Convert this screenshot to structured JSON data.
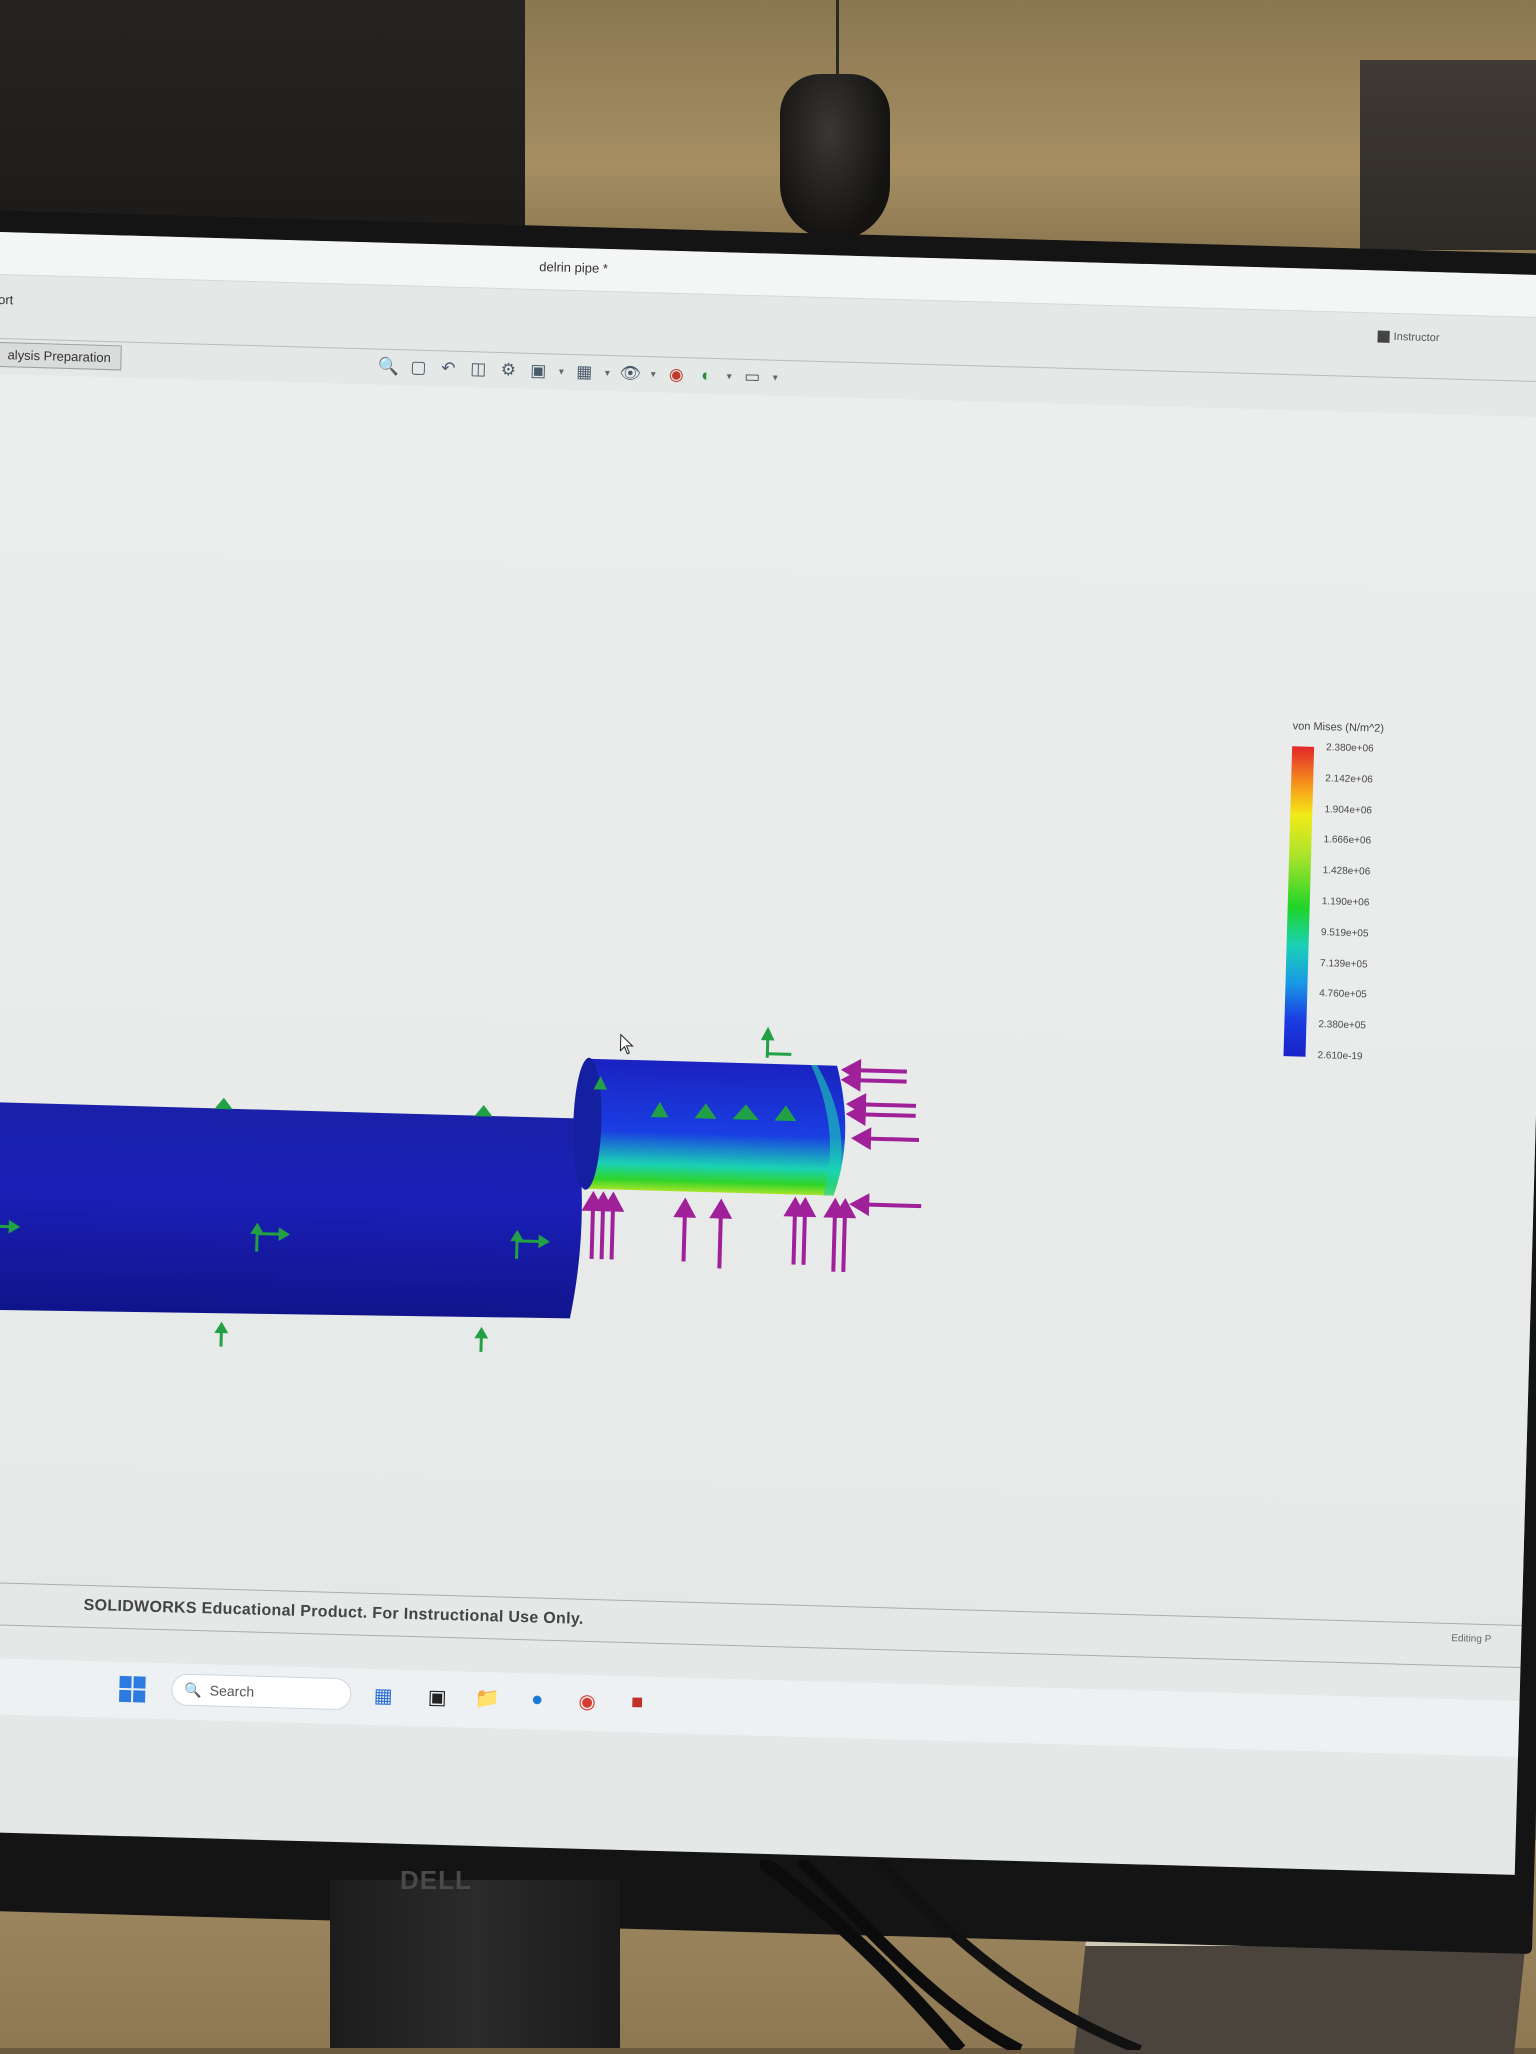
{
  "window": {
    "document_title": "delrin pipe *",
    "menu_fragment": "ort",
    "addin_label": "Instructor"
  },
  "command_tabs": {
    "active": "alysis Preparation"
  },
  "heads_up_toolbar": {
    "icons": [
      "zoom-to-fit-icon",
      "zoom-to-area-icon",
      "previous-view-icon",
      "section-view-icon",
      "dynamic-annotation-icon",
      "display-style-icon",
      "view-orientation-icon",
      "hide-show-icon",
      "edit-appearance-icon",
      "apply-scene-icon",
      "view-settings-icon"
    ]
  },
  "legend": {
    "title": "von Mises (N/m^2)",
    "values": [
      "2.380e+06",
      "2.142e+06",
      "1.904e+06",
      "1.666e+06",
      "1.428e+06",
      "1.190e+06",
      "9.519e+05",
      "7.139e+05",
      "4.760e+05",
      "2.380e+05",
      "2.610e-19"
    ],
    "colors": [
      "#e4262a",
      "#f7a51a",
      "#f2ea1a",
      "#a6e32a",
      "#1fd42a",
      "#1ad2b4",
      "#1a9ae6",
      "#1a3ee2",
      "#1a22c8"
    ]
  },
  "model": {
    "body_color": "#1b1fb8",
    "fixture_color": "#22a045",
    "load_color": "#a0209a",
    "stress_highlight_color": "#2fd42a"
  },
  "watermark": "SOLIDWORKS Educational Product. For Instructional Use Only.",
  "status_bar": {
    "right_fragment": "Editing P"
  },
  "taskbar": {
    "search_placeholder": "Search",
    "apps": [
      "task-view-icon",
      "file-explorer-icon",
      "edge-icon",
      "chrome-icon",
      "solidworks-icon"
    ]
  },
  "monitor": {
    "brand": "DELL"
  }
}
